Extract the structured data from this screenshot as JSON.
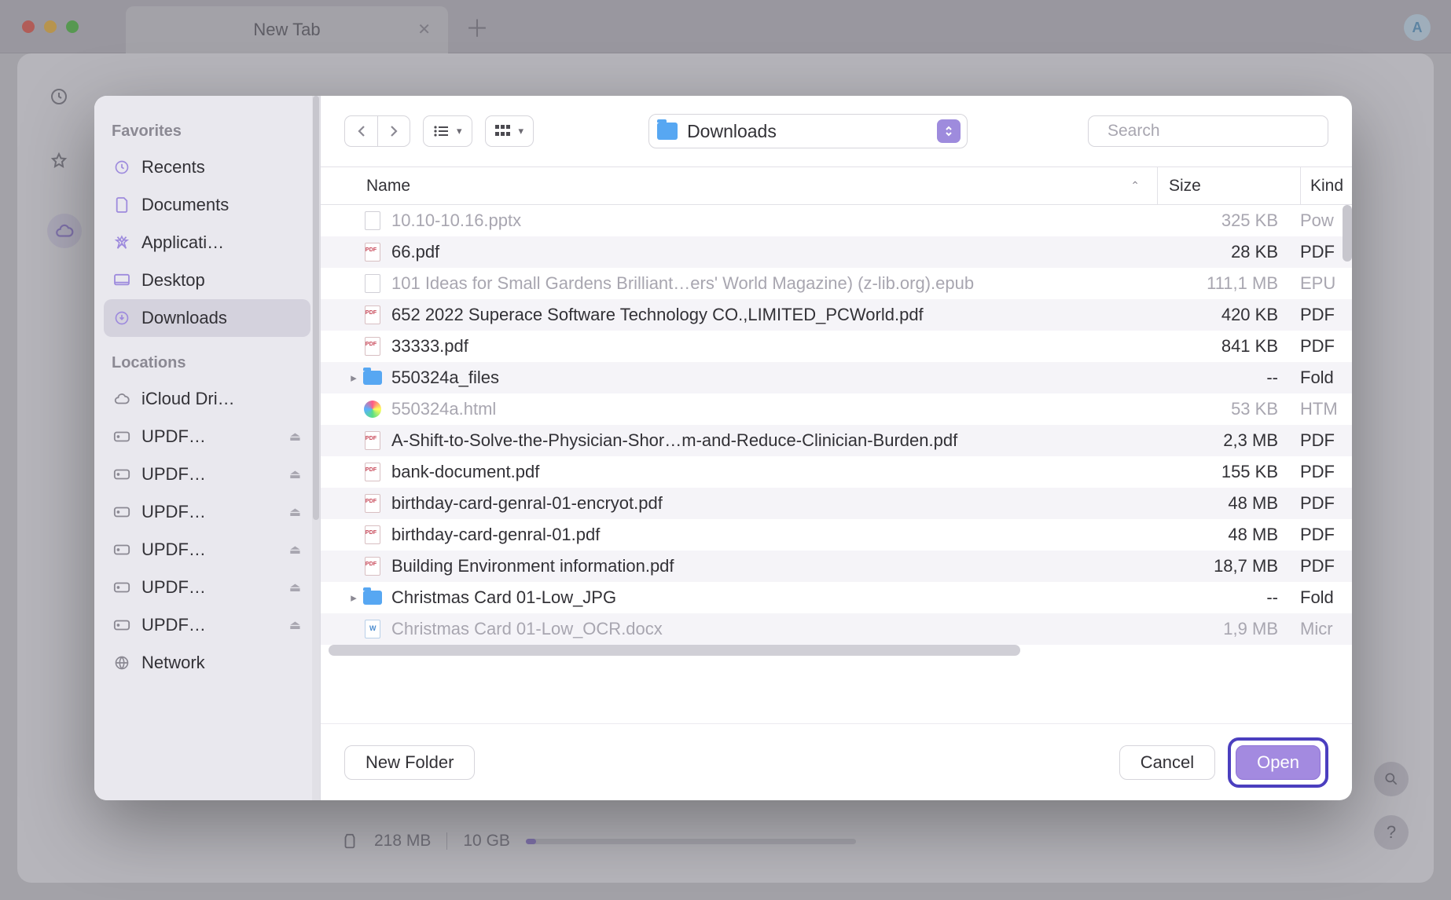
{
  "browser": {
    "tab_title": "New Tab",
    "avatar_letter": "A"
  },
  "dialog": {
    "sidebar": {
      "favorites_label": "Favorites",
      "locations_label": "Locations",
      "favorites": [
        {
          "icon": "clock",
          "label": "Recents"
        },
        {
          "icon": "doc",
          "label": "Documents"
        },
        {
          "icon": "app",
          "label": "Applicati…"
        },
        {
          "icon": "desktop",
          "label": "Desktop"
        },
        {
          "icon": "download",
          "label": "Downloads",
          "selected": true
        }
      ],
      "locations": [
        {
          "icon": "cloud",
          "label": "iCloud Dri…",
          "eject": false
        },
        {
          "icon": "disk",
          "label": "UPDF…",
          "eject": true
        },
        {
          "icon": "disk",
          "label": "UPDF…",
          "eject": true
        },
        {
          "icon": "disk",
          "label": "UPDF…",
          "eject": true
        },
        {
          "icon": "disk",
          "label": "UPDF…",
          "eject": true
        },
        {
          "icon": "disk",
          "label": "UPDF…",
          "eject": true
        },
        {
          "icon": "disk",
          "label": "UPDF…",
          "eject": true
        },
        {
          "icon": "globe",
          "label": "Network",
          "eject": false
        }
      ]
    },
    "toolbar": {
      "location": "Downloads",
      "search_placeholder": "Search"
    },
    "columns": {
      "name": "Name",
      "size": "Size",
      "kind": "Kind"
    },
    "files": [
      {
        "type": "gen",
        "name": "10.10-10.16.pptx",
        "size": "325 KB",
        "kind": "Pow",
        "dim": true
      },
      {
        "type": "pdf",
        "name": "66.pdf",
        "size": "28 KB",
        "kind": "PDF"
      },
      {
        "type": "gen",
        "name": "101 Ideas for Small Gardens Brilliant…ers' World Magazine) (z-lib.org).epub",
        "size": "111,1 MB",
        "kind": "EPU",
        "dim": true
      },
      {
        "type": "pdf",
        "name": "652  2022  Superace Software Technology CO.,LIMITED_PCWorld.pdf",
        "size": "420 KB",
        "kind": "PDF"
      },
      {
        "type": "pdf",
        "name": "33333.pdf",
        "size": "841 KB",
        "kind": "PDF"
      },
      {
        "type": "fold",
        "name": "550324a_files",
        "size": "--",
        "kind": "Fold",
        "expandable": true
      },
      {
        "type": "html",
        "name": "550324a.html",
        "size": "53 KB",
        "kind": "HTM",
        "dim": true
      },
      {
        "type": "pdf",
        "name": "A-Shift-to-Solve-the-Physician-Shor…m-and-Reduce-Clinician-Burden.pdf",
        "size": "2,3 MB",
        "kind": "PDF"
      },
      {
        "type": "pdf",
        "name": "bank-document.pdf",
        "size": "155 KB",
        "kind": "PDF"
      },
      {
        "type": "pdf",
        "name": "birthday-card-genral-01-encryot.pdf",
        "size": "48 MB",
        "kind": "PDF"
      },
      {
        "type": "pdf",
        "name": "birthday-card-genral-01.pdf",
        "size": "48 MB",
        "kind": "PDF"
      },
      {
        "type": "pdf",
        "name": "Building Environment information.pdf",
        "size": "18,7 MB",
        "kind": "PDF"
      },
      {
        "type": "fold",
        "name": "Christmas Card 01-Low_JPG",
        "size": "--",
        "kind": "Fold",
        "expandable": true
      },
      {
        "type": "doc",
        "name": "Christmas Card 01-Low_OCR.docx",
        "size": "1,9 MB",
        "kind": "Micr",
        "dim": true
      }
    ],
    "footer": {
      "new_folder": "New Folder",
      "cancel": "Cancel",
      "open": "Open"
    }
  },
  "storage": {
    "used": "218 MB",
    "total": "10 GB"
  }
}
